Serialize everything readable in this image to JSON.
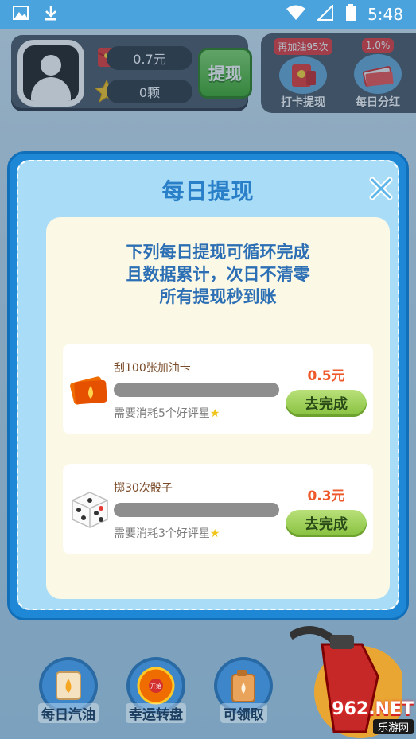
{
  "status_bar": {
    "time": "5:48",
    "icons": [
      "image-icon",
      "download-icon",
      "wifi-icon",
      "signal-icon",
      "battery-icon"
    ]
  },
  "header": {
    "cash_balance": "0.7元",
    "star_count": "0颗",
    "withdraw_button": "提现",
    "features": [
      {
        "badge": "再加油95次",
        "label": "打卡提现",
        "icon": "red-envelope-icon"
      },
      {
        "badge": "1.0%",
        "label": "每日分红",
        "icon": "money-stack-icon"
      }
    ]
  },
  "modal": {
    "title": "每日提现",
    "description": [
      "下列每日提现可循环完成",
      "且数据累计，次日不清零",
      "所有提现秒到账"
    ],
    "tasks": [
      {
        "name": "刮100张加油卡",
        "cost": "需要消耗5个好评星",
        "reward": "0.5元",
        "button": "去完成",
        "icon": "fuel-card-icon",
        "progress": 0
      },
      {
        "name": "掷30次骰子",
        "cost": "需要消耗3个好评星",
        "reward": "0.3元",
        "button": "去完成",
        "icon": "dice-icon",
        "progress": 0
      }
    ]
  },
  "bottom_bar": {
    "items": [
      {
        "label": "每日汽油",
        "icon": "scroll-fuel-icon"
      },
      {
        "label": "幸运转盘",
        "icon": "wheel-icon",
        "sublabel": "开始"
      },
      {
        "label": "可领取",
        "icon": "fuel-can-icon"
      }
    ]
  },
  "watermark": {
    "top": "962.NET",
    "bottom": "乐游网"
  },
  "colors": {
    "modal_blue": "#1e88d7",
    "title_blue": "#2a7fc9",
    "reward_orange": "#ef5a2c",
    "button_green": "#86c13e"
  }
}
